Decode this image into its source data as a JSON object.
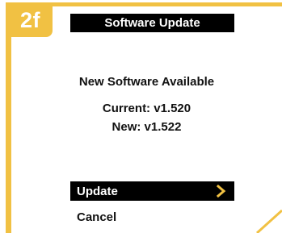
{
  "step": {
    "label": "2f"
  },
  "screen": {
    "title": "Software Update",
    "heading": "New Software Available",
    "current_line": "Current: v1.520",
    "new_line": "New: v1.522"
  },
  "menu": {
    "items": [
      {
        "label": "Update",
        "selected": true,
        "icon": "chevron-right-icon"
      },
      {
        "label": "Cancel",
        "selected": false
      }
    ]
  },
  "colors": {
    "frame": "#f1c143",
    "title_bar": "#000000",
    "selected_item": "#000000",
    "chevron": "#f1c143"
  }
}
